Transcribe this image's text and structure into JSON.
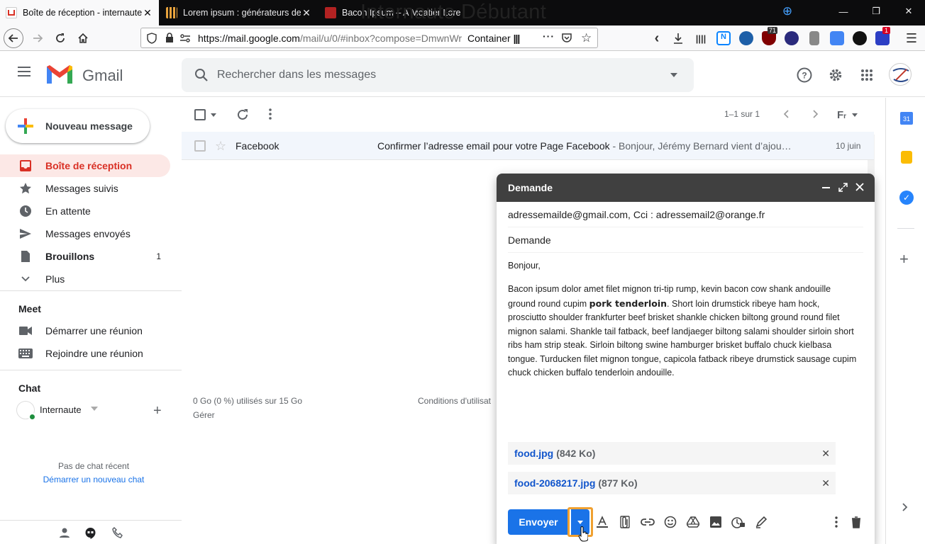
{
  "browser": {
    "tabs": [
      {
        "title": "Boîte de réception - internaute",
        "active": true
      },
      {
        "title": "Lorem ipsum : générateurs de f",
        "active": false
      },
      {
        "title": "Bacon Ipsum – A Meatier Lore",
        "active": false
      }
    ],
    "overlay_title": "Internaute Débutant",
    "url_prefix": "https://mail.google.com",
    "url_rest": "/mail/u/0/#inbox?compose=DmwnWr",
    "container_label": "Container",
    "ext_badges": {
      "ublock": "71",
      "mail": "1"
    }
  },
  "gmail": {
    "product_name": "Gmail",
    "search_placeholder": "Rechercher dans les messages"
  },
  "sidebar": {
    "compose_label": "Nouveau message",
    "items": [
      {
        "label": "Boîte de réception",
        "icon": "inbox-icon",
        "selected": true,
        "count": ""
      },
      {
        "label": "Messages suivis",
        "icon": "star-icon",
        "selected": false,
        "count": ""
      },
      {
        "label": "En attente",
        "icon": "clock-icon",
        "selected": false,
        "count": ""
      },
      {
        "label": "Messages envoyés",
        "icon": "send-icon",
        "selected": false,
        "count": ""
      },
      {
        "label": "Brouillons",
        "icon": "draft-icon",
        "selected": false,
        "count": "1"
      },
      {
        "label": "Plus",
        "icon": "chevron-down-icon",
        "selected": false,
        "count": ""
      }
    ],
    "meet_title": "Meet",
    "meet_items": [
      {
        "label": "Démarrer une réunion",
        "icon": "video-icon"
      },
      {
        "label": "Rejoindre une réunion",
        "icon": "keyboard-icon"
      }
    ],
    "chat_title": "Chat",
    "chat_user": "Internaute",
    "no_chat": "Pas de chat récent",
    "start_chat": "Démarrer un nouveau chat"
  },
  "list": {
    "pagination": "1–1 sur 1",
    "rows": [
      {
        "sender": "Facebook",
        "subject": "Confirmer l’adresse email pour votre Page Facebook",
        "snippet": " - Bonjour, Jérémy Bernard vient d’ajou…",
        "date": "10 juin"
      }
    ],
    "storage": "0 Go (0 %) utilisés sur 15 Go",
    "manage": "Gérer",
    "terms": "Conditions d'utilisat"
  },
  "compose": {
    "title": "Demande",
    "recipients": "adressemailde@gmail.com, Cci : adressemail2@orange.fr",
    "subject": "Demande",
    "greeting": "Bonjour,",
    "body_part1": "Bacon ipsum dolor amet filet mignon tri-tip rump, kevin bacon cow shank andouille ground round cupim ",
    "body_bold": "pork tenderloin",
    "body_part2": ". Short loin drumstick ribeye ham hock, prosciutto shoulder frankfurter beef brisket shankle chicken biltong ground round filet mignon salami. Shankle tail fatback, beef landjaeger biltong salami shoulder sirloin short ribs ham strip steak. Sirloin biltong swine hamburger brisket buffalo chuck kielbasa tongue. Turducken filet mignon tongue, capicola fatback ribeye drumstick sausage cupim chuck chicken buffalo tenderloin andouille.",
    "attachments": [
      {
        "name": "food.jpg",
        "size": "(842 Ko)"
      },
      {
        "name": "food-2068217.jpg",
        "size": "(877 Ko)"
      }
    ],
    "send_label": "Envoyer"
  }
}
